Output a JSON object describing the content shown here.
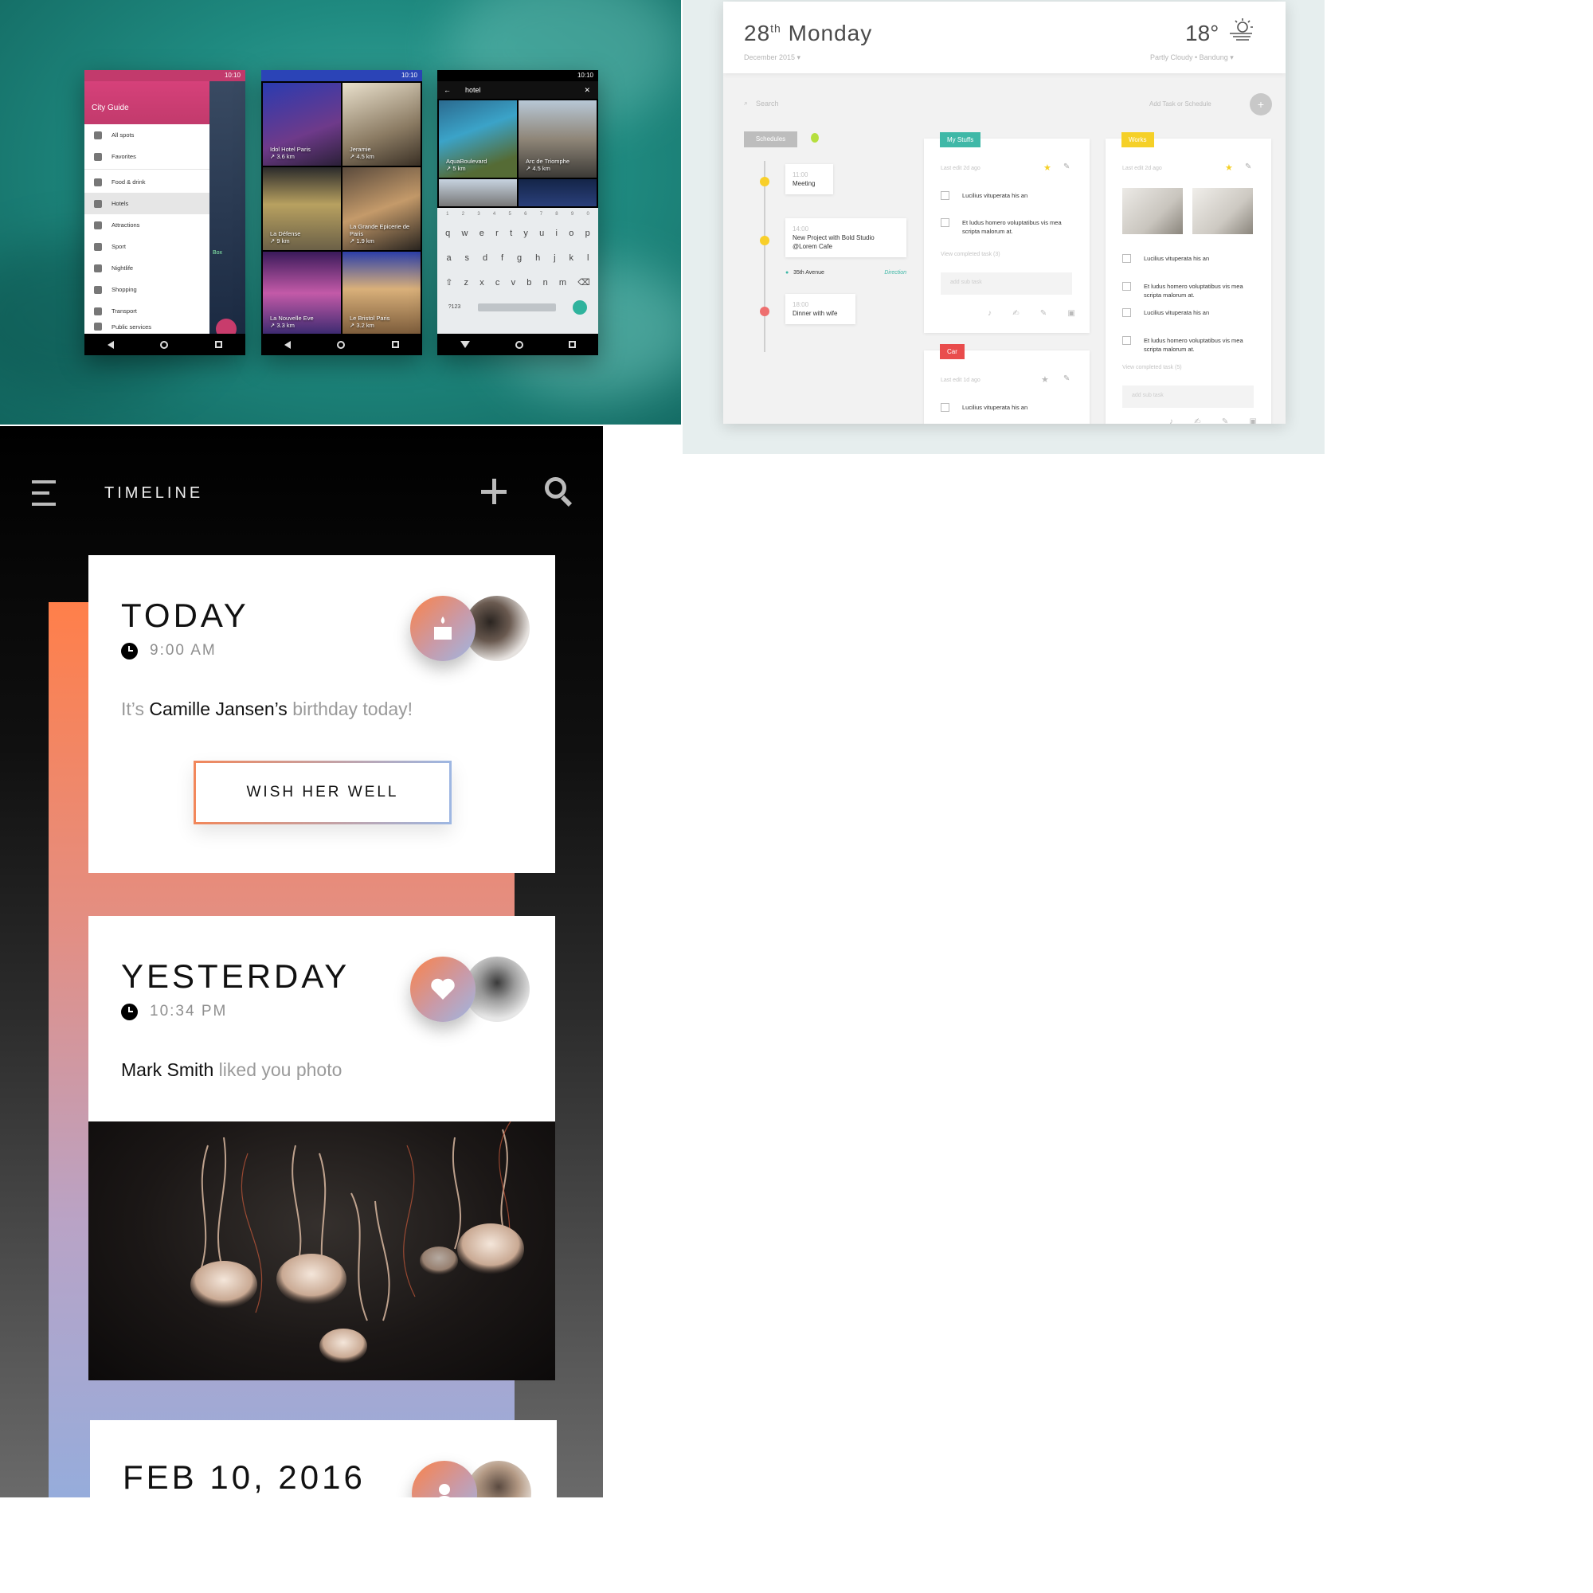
{
  "phones": {
    "status_time": "10:10",
    "drawer": {
      "title": "City Guide",
      "items": [
        {
          "label": "All spots",
          "icon": "pin-icon"
        },
        {
          "label": "Favorites",
          "icon": "heart-icon"
        },
        {
          "label": "Food & drink",
          "icon": "fork-knife-icon"
        },
        {
          "label": "Hotels",
          "icon": "bed-icon"
        },
        {
          "label": "Attractions",
          "icon": "camera-icon"
        },
        {
          "label": "Sport",
          "icon": "ball-icon"
        },
        {
          "label": "Nightlife",
          "icon": "cocktail-icon"
        },
        {
          "label": "Shopping",
          "icon": "basket-icon"
        },
        {
          "label": "Transport",
          "icon": "bus-icon"
        },
        {
          "label": "Public services",
          "icon": "building-icon"
        }
      ],
      "side_text": "Box"
    },
    "grid": [
      {
        "name": "Idol Hotel Paris",
        "dist": "↗ 3.6 km"
      },
      {
        "name": "Jeramie",
        "dist": "↗ 4.5 km"
      },
      {
        "name": "La Défense",
        "dist": "↗ 9 km"
      },
      {
        "name": "La Grande Epicerie de Paris",
        "dist": "↗ 1.9 km"
      },
      {
        "name": "La Nouvelle Eve",
        "dist": "↗ 3.3 km"
      },
      {
        "name": "Le Bristol Paris",
        "dist": "↗ 3.2 km"
      }
    ],
    "search": {
      "query": "hotel",
      "results": [
        {
          "name": "AquaBoulevard",
          "dist": "↗ 5 km"
        },
        {
          "name": "Arc de Triomphe",
          "dist": "↗ 4.5 km"
        }
      ],
      "keyboard": {
        "numbers": [
          "1",
          "2",
          "3",
          "4",
          "5",
          "6",
          "7",
          "8",
          "9",
          "0"
        ],
        "row1": [
          "q",
          "w",
          "e",
          "r",
          "t",
          "y",
          "u",
          "i",
          "o",
          "p"
        ],
        "row2": [
          "a",
          "s",
          "d",
          "f",
          "g",
          "h",
          "j",
          "k",
          "l"
        ],
        "row3": [
          "z",
          "x",
          "c",
          "v",
          "b",
          "n",
          "m"
        ],
        "sym": "?123"
      }
    }
  },
  "dashboard": {
    "date_day": "28",
    "date_sup": "th",
    "weekday": "Monday",
    "month": "December 2015",
    "temp": "18°",
    "weather": "Partly Cloudy • Bandung",
    "search_placeholder": "Search",
    "add_label": "Add Task or Schedule",
    "schedules_tag": "Schedules",
    "schedules": [
      {
        "time": "11:00",
        "title": "Meeting",
        "color": "#f8cf2a"
      },
      {
        "time": "14:00",
        "title": "New Project with Bold Studio @Lorem Cafe",
        "color": "#f8cf2a",
        "location": "35th Avenue",
        "direction": "Direction"
      },
      {
        "time": "18:00",
        "title": "Dinner with wife",
        "color": "#ee6f6f"
      }
    ],
    "lists": [
      {
        "tag": "My Stuffs",
        "color": "#3fb8a7",
        "edit": "Last edit 2d ago",
        "tasks": [
          "Lucilius vituperata his an",
          "Et ludus homero voluptatibus vis mea scripta malorum at."
        ],
        "completed": "View completed task (3)",
        "subtask": "add sub task"
      },
      {
        "tag": "Car",
        "color": "#e94c4c",
        "edit": "Last edit 1d ago",
        "tasks": [
          "Lucilius vituperata his an"
        ]
      },
      {
        "tag": "Works",
        "color": "#f5d028",
        "edit": "Last edit 2d ago",
        "tasks": [
          "Lucilius vituperata his an",
          "Et ludus homero voluptatibus vis mea scripta malorum at.",
          "Lucilius vituperata his an",
          "Et ludus homero voluptatibus vis mea scripta malorum at."
        ],
        "completed": "View completed task (5)",
        "subtask": "add sub task"
      }
    ]
  },
  "timeline": {
    "title": "TIMELINE",
    "cards": [
      {
        "heading": "TODAY",
        "time": "9:00 AM",
        "text_pre": "It’s ",
        "text_name": "Camille Jansen’s",
        "text_post": " birthday today!",
        "button": "WISH HER WELL",
        "icon": "birthday-cake-icon"
      },
      {
        "heading": "YESTERDAY",
        "time": "10:34 PM",
        "text_name": "Mark Smith",
        "text_post": " liked you photo",
        "icon": "heart-icon"
      },
      {
        "heading": "FEB 10, 2016",
        "icon": "user-check-icon"
      }
    ],
    "colors": {
      "accent_start": "#f2875a",
      "accent_end": "#9db7e3"
    }
  }
}
